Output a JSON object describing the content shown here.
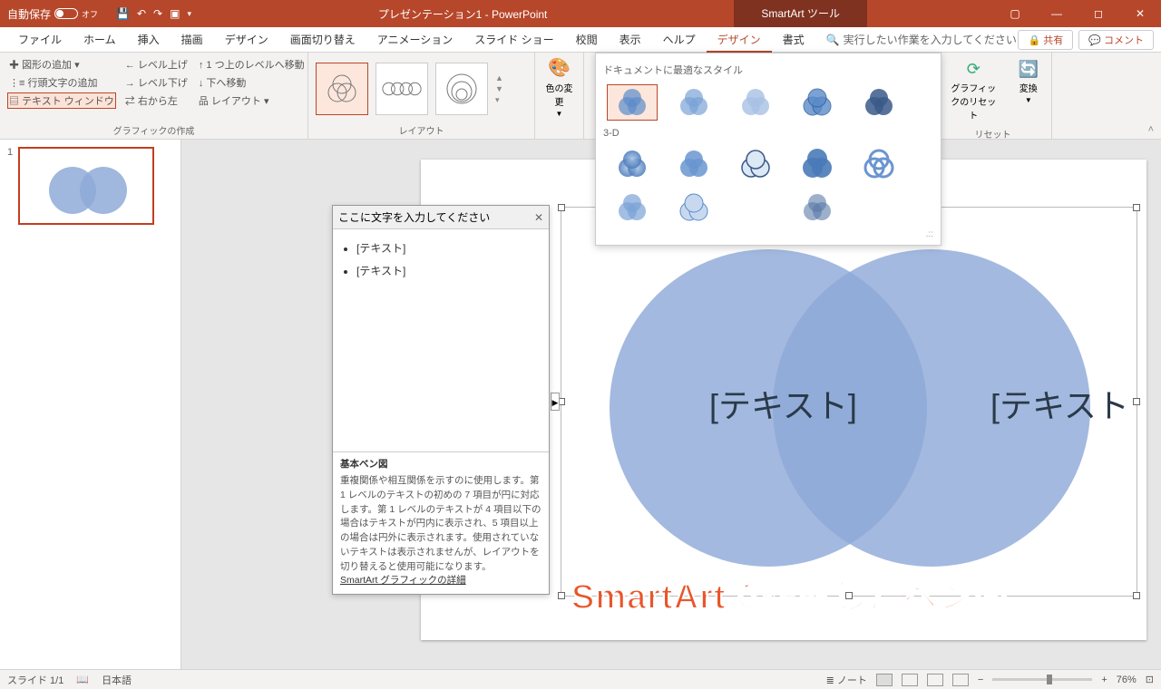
{
  "titlebar": {
    "autosave_label": "自動保存",
    "autosave_state": "オフ",
    "title": "プレゼンテーション1  -  PowerPoint",
    "tool_context": "SmartArt ツール"
  },
  "tabs": {
    "file": "ファイル",
    "home": "ホーム",
    "insert": "挿入",
    "draw": "描画",
    "design": "デザイン",
    "transitions": "画面切り替え",
    "animations": "アニメーション",
    "slideshow": "スライド ショー",
    "review": "校閲",
    "view": "表示",
    "help": "ヘルプ",
    "sa_design": "デザイン",
    "sa_format": "書式",
    "search_placeholder": "実行したい作業を入力してください",
    "share": "共有",
    "comments": "コメント"
  },
  "ribbon": {
    "group_create": "グラフィックの作成",
    "add_shape": "図形の追加",
    "add_bullet": "行頭文字の追加",
    "text_pane": "テキスト ウィンドウ",
    "level_up": "レベル上げ",
    "level_down": "レベル下げ",
    "rtl": "右から左",
    "move_parent": "1 つ上のレベルへ移動",
    "move_down": "下へ移動",
    "layout_btn": "レイアウト",
    "group_layout": "レイアウト",
    "change_colors": "色の変更",
    "group_reset": "リセット",
    "reset_graphic": "グラフィックのリセット",
    "convert": "変換"
  },
  "gallery": {
    "best_match": "ドキュメントに最適なスタイル",
    "three_d": "3-D"
  },
  "textpane": {
    "header": "ここに文字を入力してください",
    "item1": "[テキスト]",
    "item2": "[テキスト]",
    "info_title": "基本ベン図",
    "info_body": "重複関係や相互関係を示すのに使用します。第 1 レベルのテキストの初めの 7 項目が円に対応します。第 1 レベルのテキストが 4 項目以下の場合はテキストが円内に表示され、5 項目以上の場合は円外に表示されます。使用されていないテキストは表示されませんが、レイアウトを切り替えると使用可能になります。",
    "info_link": "SmartArt グラフィックの詳細"
  },
  "slide": {
    "left_text": "[テキスト]",
    "right_text": "[テキスト]",
    "caption": "SmartArtで作成したベン図",
    "thumb_number": "1"
  },
  "status": {
    "slide": "スライド 1/1",
    "lang": "日本語",
    "notes": "ノート",
    "zoom": "76%"
  }
}
